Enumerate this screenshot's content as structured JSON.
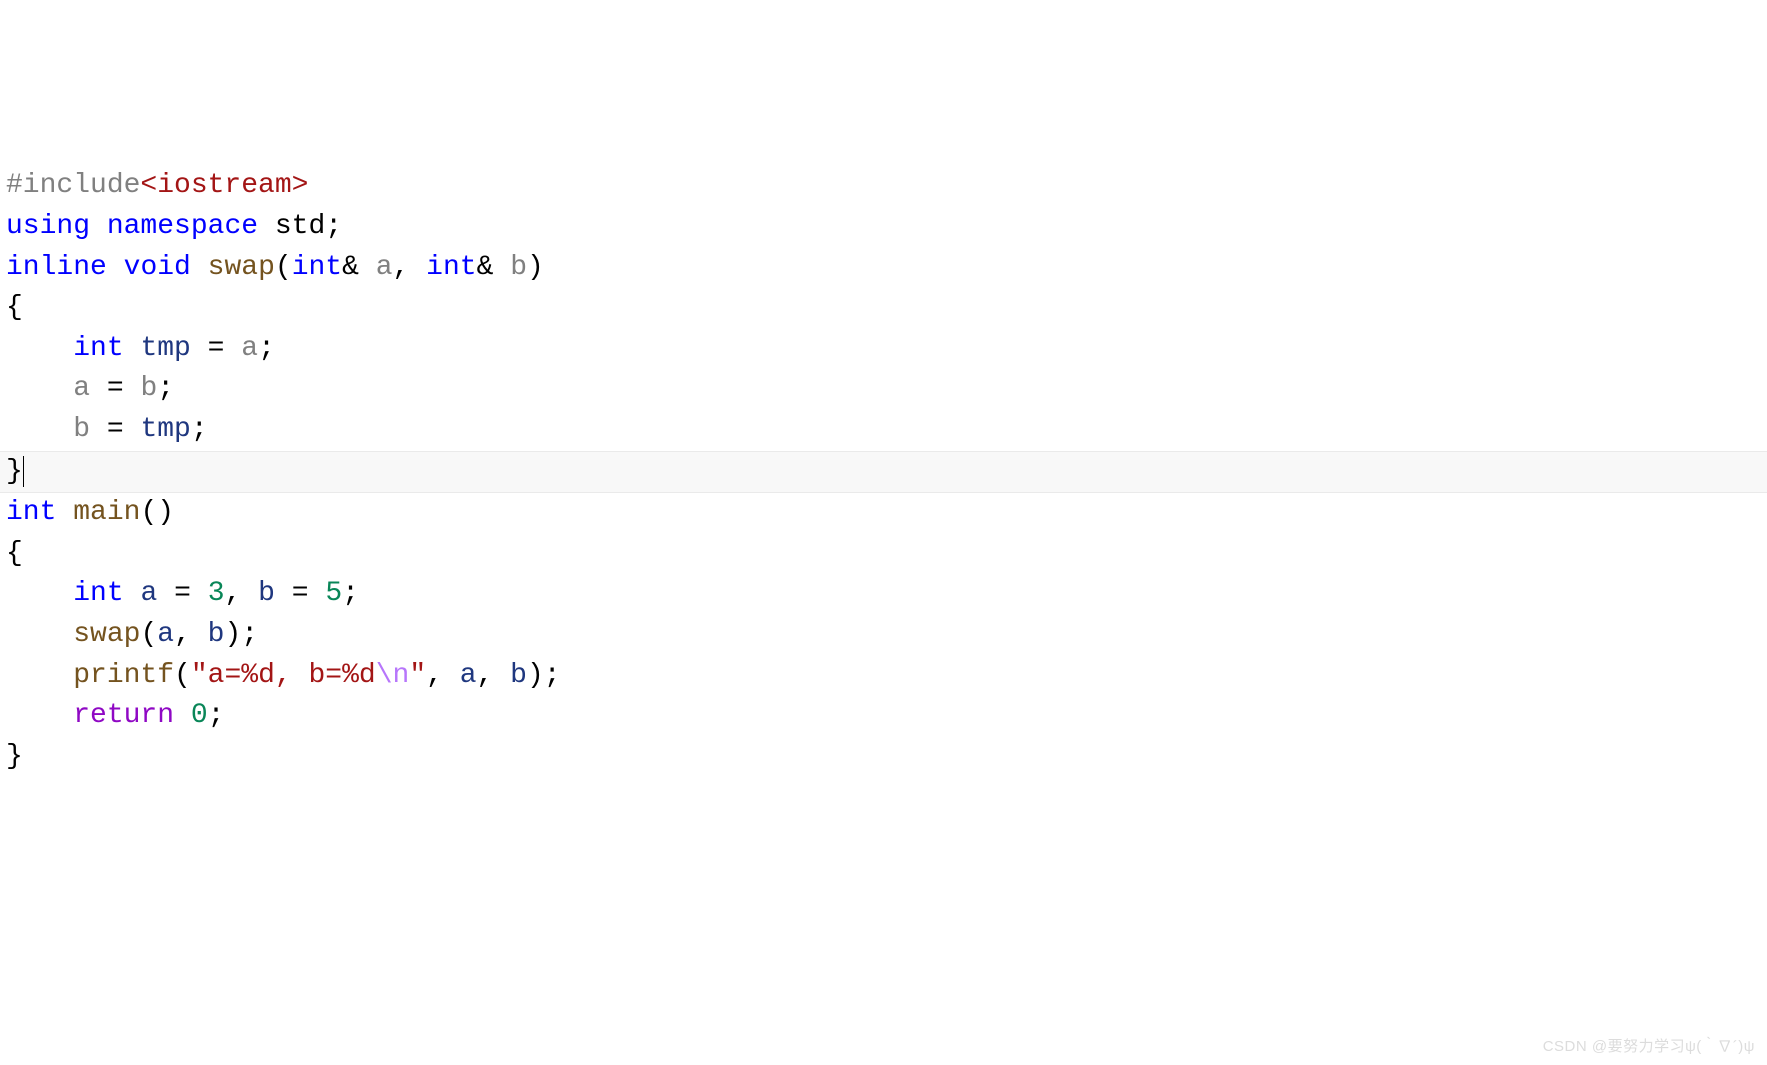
{
  "code": {
    "line1": {
      "hash_include": "#include",
      "header": "<iostream>"
    },
    "line2": {
      "using": "using",
      "namespace": "namespace",
      "std": " std;"
    },
    "line3": {
      "inline": "inline",
      "void": "void",
      "swap": "swap",
      "paren_open": "(",
      "int1": "int",
      "amp1": "& ",
      "a": "a",
      "comma": ", ",
      "int2": "int",
      "amp2": "& ",
      "b": "b",
      "paren_close": ")"
    },
    "line4": {
      "brace": "{"
    },
    "line5": {
      "indent": "    ",
      "int": "int",
      "sp1": " ",
      "tmp": "tmp",
      "sp2": " = ",
      "a": "a",
      "semi": ";"
    },
    "line6": {
      "indent": "    ",
      "a": "a",
      "sp": " = ",
      "b": "b",
      "semi": ";"
    },
    "line7": {
      "indent": "    ",
      "b": "b",
      "sp": " = ",
      "tmp": "tmp",
      "semi": ";"
    },
    "line8": {
      "brace": "}"
    },
    "line9": {
      "int": "int",
      "sp": " ",
      "main": "main",
      "parens": "()"
    },
    "line10": {
      "brace": "{"
    },
    "line11": {
      "indent": "    ",
      "int": "int",
      "sp": " ",
      "a": "a",
      "eq1": " = ",
      "three": "3",
      "comma": ", ",
      "b": "b",
      "eq2": " = ",
      "five": "5",
      "semi": ";"
    },
    "line12": {
      "indent": "    ",
      "swap": "swap",
      "open": "(",
      "a": "a",
      "comma": ", ",
      "b": "b",
      "close": ");"
    },
    "line13": {
      "indent": "    ",
      "printf": "printf",
      "open": "(",
      "str": "\"a=%d, b=%d",
      "esc": "\\n",
      "strend": "\"",
      "comma1": ", ",
      "a": "a",
      "comma2": ", ",
      "b": "b",
      "close": ");"
    },
    "line14": {
      "indent": "    ",
      "return": "return",
      "sp": " ",
      "zero": "0",
      "semi": ";"
    },
    "line15": {
      "brace": "}"
    }
  },
  "watermark": "CSDN @要努力学习ψ(｀∇´)ψ"
}
